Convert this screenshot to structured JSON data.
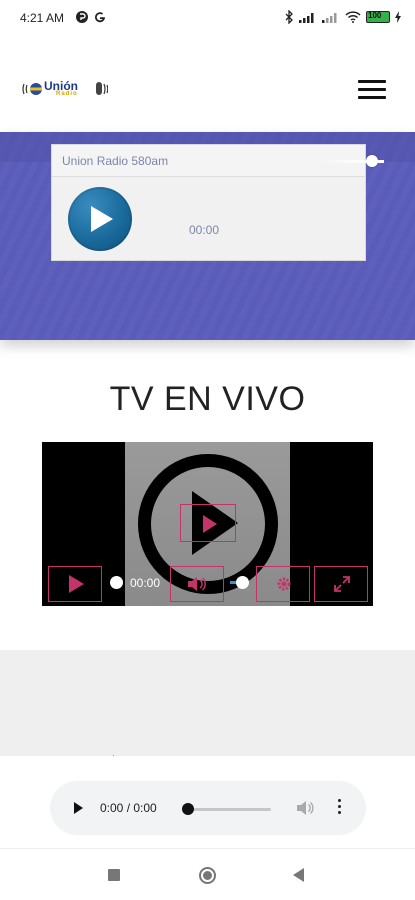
{
  "status_bar": {
    "time": "4:21 AM",
    "battery_level": "100",
    "icons": [
      "notification-icon",
      "google-icon",
      "bluetooth-icon",
      "signal-icon",
      "signal-icon",
      "wifi-icon",
      "battery-icon",
      "charging-icon"
    ]
  },
  "header": {
    "logo_text": "Unión",
    "logo_subtext": "Radio",
    "menu_icon": "hamburger-menu-icon"
  },
  "radio_player": {
    "station_name": "Union Radio 580am",
    "time": "00:00",
    "accent_color": "#1a6a9c"
  },
  "tv": {
    "title": "TV EN VIVO",
    "time": "00:00",
    "accent_color": "#c4336a"
  },
  "audio_player": {
    "time": "0:00 / 0:00",
    "progress": 0
  },
  "colors": {
    "hero_band": "#5a5cb8",
    "page_bg": "#ffffff",
    "grey_section": "#efefef"
  }
}
